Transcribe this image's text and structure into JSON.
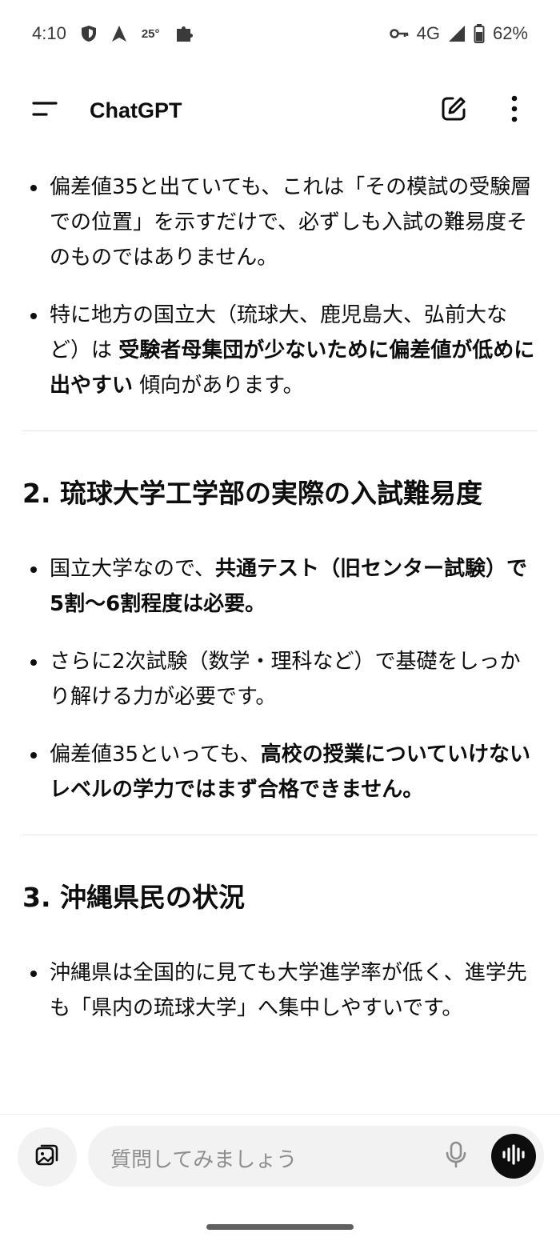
{
  "status_bar": {
    "time": "4:10",
    "temperature": "25°",
    "network": "4G",
    "battery": "62%"
  },
  "app_bar": {
    "title": "ChatGPT"
  },
  "content": {
    "section1_bullets": [
      [
        {
          "text": "偏差値35と出ていても、これは「その模試の受験層での位置」を示すだけで、必ずしも入試の難易度そのものではありません。",
          "bold": false
        }
      ],
      [
        {
          "text": "特に地方の国立大（琉球大、鹿児島大、弘前大など）は ",
          "bold": false
        },
        {
          "text": "受験者母集団が少ないために偏差値が低めに出やすい",
          "bold": true
        },
        {
          "text": " 傾向があります。",
          "bold": false
        }
      ]
    ],
    "section2_title": "2. 琉球大学工学部の実際の入試難易度",
    "section2_bullets": [
      [
        {
          "text": "国立大学なので、",
          "bold": false
        },
        {
          "text": "共通テスト（旧センター試験）で5割〜6割程度は必要。",
          "bold": true
        }
      ],
      [
        {
          "text": "さらに2次試験（数学・理科など）で基礎をしっかり解ける力が必要です。",
          "bold": false
        }
      ],
      [
        {
          "text": "偏差値35といっても、",
          "bold": false
        },
        {
          "text": "高校の授業についていけないレベルの学力ではまず合格できません。",
          "bold": true
        }
      ]
    ],
    "section3_title": "3. 沖縄県民の状況",
    "section3_bullets": [
      [
        {
          "text": "沖縄県は全国的に見ても大学進学率が低く、進学先も「県内の琉球大学」へ集中しやすいです。",
          "bold": false
        }
      ]
    ]
  },
  "composer": {
    "placeholder": "質問してみましょう"
  },
  "icons": {
    "shield": "shield-icon",
    "navigation": "navigation-arrow-icon",
    "puzzle": "puzzle-icon",
    "key": "key-icon",
    "signal": "signal-icon",
    "battery": "battery-icon",
    "menu": "menu-icon",
    "new_chat": "new-chat-icon",
    "more": "more-vertical-icon",
    "attach": "attach-image-icon",
    "mic": "microphone-icon",
    "voice": "voice-mode-icon"
  }
}
